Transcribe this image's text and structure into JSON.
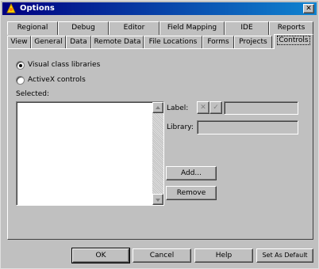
{
  "window": {
    "title": "Options",
    "close_glyph": "✕"
  },
  "tabs_back": [
    {
      "label": "Regional"
    },
    {
      "label": "Debug"
    },
    {
      "label": "Editor"
    },
    {
      "label": "Field Mapping"
    },
    {
      "label": "IDE"
    },
    {
      "label": "Reports"
    }
  ],
  "tabs_front": [
    {
      "label": "View"
    },
    {
      "label": "General"
    },
    {
      "label": "Data"
    },
    {
      "label": "Remote Data"
    },
    {
      "label": "File Locations"
    },
    {
      "label": "Forms"
    },
    {
      "label": "Projects"
    },
    {
      "label": "Controls"
    }
  ],
  "active_tab": "Controls",
  "controls": {
    "radio_visual": {
      "label": "Visual class libraries",
      "checked": true
    },
    "radio_activex": {
      "label": "ActiveX controls",
      "checked": false
    },
    "selected_label": "Selected:",
    "label_field_label": "Label:",
    "library_field_label": "Library:",
    "label_value": "",
    "library_value": "",
    "cancel_glyph": "✕",
    "ok_glyph": "✓",
    "add_button": "Add...",
    "remove_button": "Remove"
  },
  "footer": {
    "ok": "OK",
    "cancel": "Cancel",
    "help": "Help",
    "set_default": "Set As Default"
  }
}
